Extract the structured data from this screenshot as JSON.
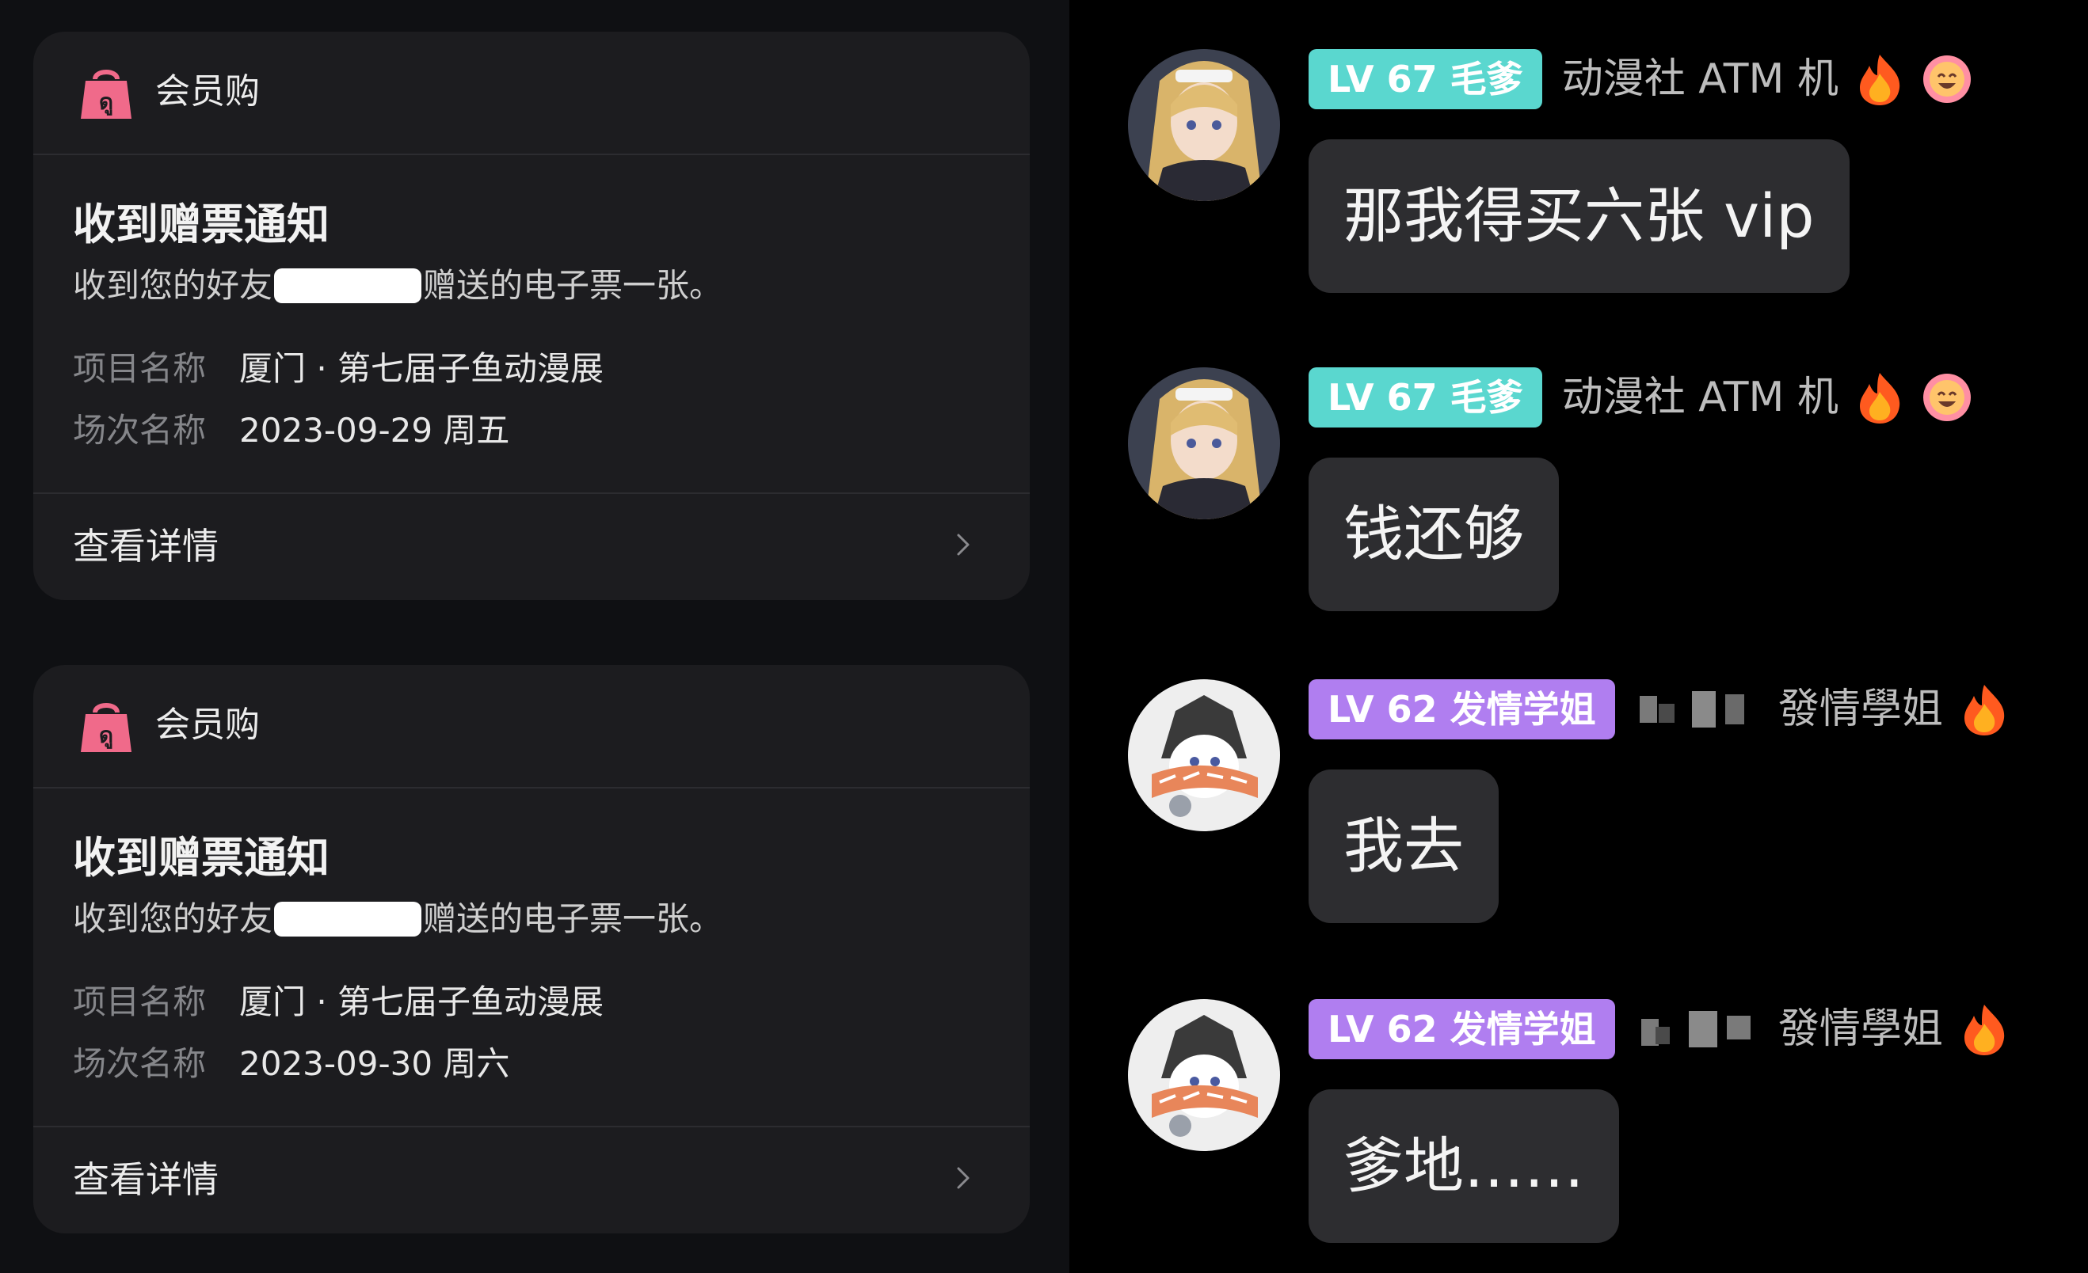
{
  "cards": [
    {
      "app_name": "会员购",
      "title": "收到赠票通知",
      "desc_before": "收到您的好友",
      "desc_after": "赠送的电子票一张。",
      "item_label": "项目名称",
      "item_value": "厦门 · 第七届子鱼动漫展",
      "session_label": "场次名称",
      "session_value": "2023-09-29 周五",
      "link_label": "查看详情"
    },
    {
      "app_name": "会员购",
      "title": "收到赠票通知",
      "desc_before": "收到您的好友",
      "desc_after": "赠送的电子票一张。",
      "item_label": "项目名称",
      "item_value": "厦门 · 第七届子鱼动漫展",
      "session_label": "场次名称",
      "session_value": "2023-09-30 周六",
      "link_label": "查看详情"
    }
  ],
  "messages": [
    {
      "badge": "LV 67 毛爹",
      "badge_color": "#5ad7cf",
      "user": "动漫社 ATM 机",
      "text": "那我得买六张 vip",
      "icons": [
        "fire-icon",
        "smile-face-icon"
      ]
    },
    {
      "badge": "LV 67 毛爹",
      "badge_color": "#5ad7cf",
      "user": "动漫社 ATM 机",
      "text": "钱还够",
      "icons": [
        "fire-icon",
        "smile-face-icon"
      ]
    },
    {
      "badge": "LV 62 发情学姐",
      "badge_color": "#b07ef0",
      "user": "發情學姐",
      "text": "我去",
      "icons": [
        "fire-icon"
      ]
    },
    {
      "badge": "LV 62 发情学姐",
      "badge_color": "#b07ef0",
      "user": "發情學姐",
      "text": "爹地……",
      "icons": [
        "fire-icon"
      ]
    }
  ],
  "colors": {
    "card_bg": "#1c1c1f",
    "bubble_bg": "#2d2d30",
    "logo_pink": "#f06a8a"
  }
}
